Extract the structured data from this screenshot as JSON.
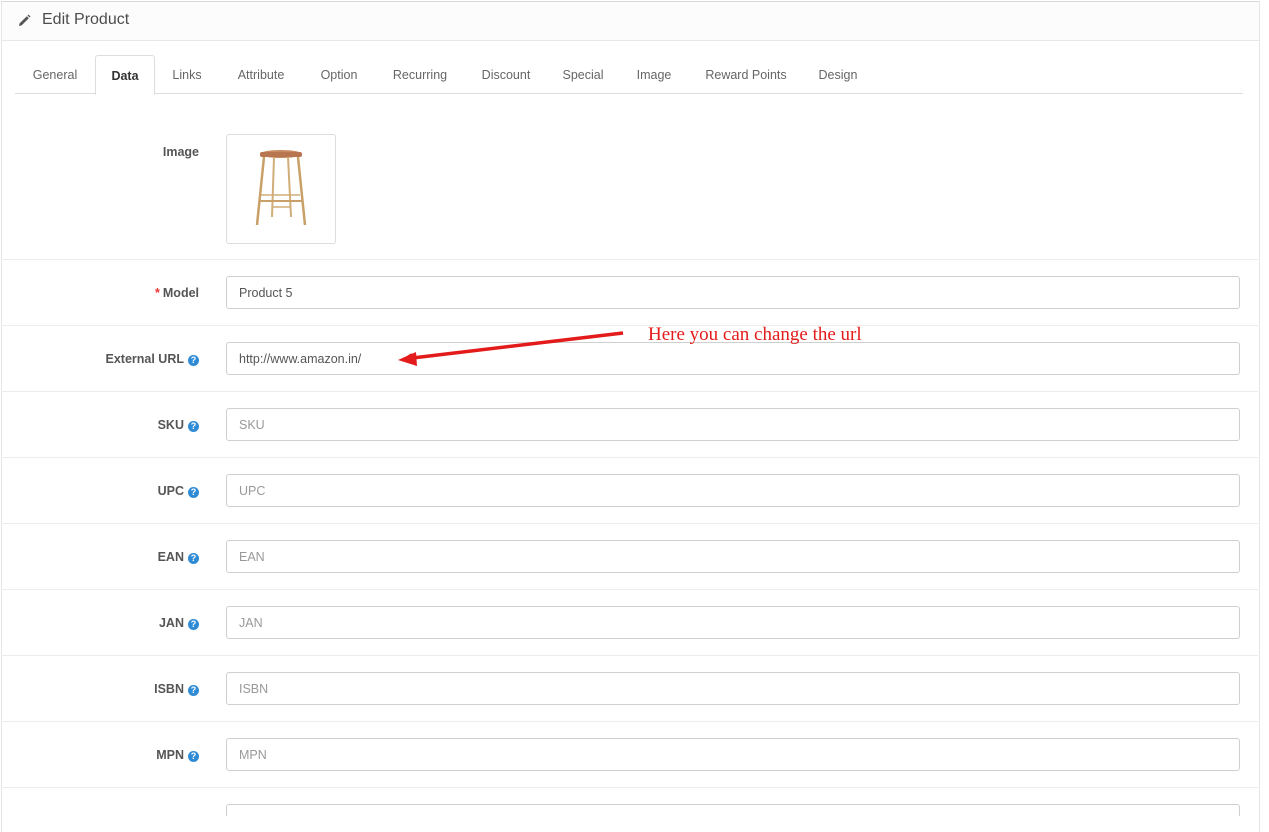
{
  "header": {
    "title": "Edit Product"
  },
  "tabs": [
    {
      "label": "General"
    },
    {
      "label": "Data"
    },
    {
      "label": "Links"
    },
    {
      "label": "Attribute"
    },
    {
      "label": "Option"
    },
    {
      "label": "Recurring"
    },
    {
      "label": "Discount"
    },
    {
      "label": "Special"
    },
    {
      "label": "Image"
    },
    {
      "label": "Reward Points"
    },
    {
      "label": "Design"
    }
  ],
  "active_tab": "Data",
  "form": {
    "image_label": "Image",
    "model": {
      "label": "Model",
      "required_mark": "*",
      "value": "Product 5"
    },
    "external_url": {
      "label": "External URL",
      "value": "http://www.amazon.in/"
    },
    "sku": {
      "label": "SKU",
      "placeholder": "SKU"
    },
    "upc": {
      "label": "UPC",
      "placeholder": "UPC"
    },
    "ean": {
      "label": "EAN",
      "placeholder": "EAN"
    },
    "jan": {
      "label": "JAN",
      "placeholder": "JAN"
    },
    "isbn": {
      "label": "ISBN",
      "placeholder": "ISBN"
    },
    "mpn": {
      "label": "MPN",
      "placeholder": "MPN"
    },
    "help_glyph": "?"
  },
  "annotation": {
    "text": "Here you can change the url",
    "color": "#e31b1b"
  },
  "colors": {
    "help_icon": "#2f8bd6",
    "required": "#e33333"
  }
}
